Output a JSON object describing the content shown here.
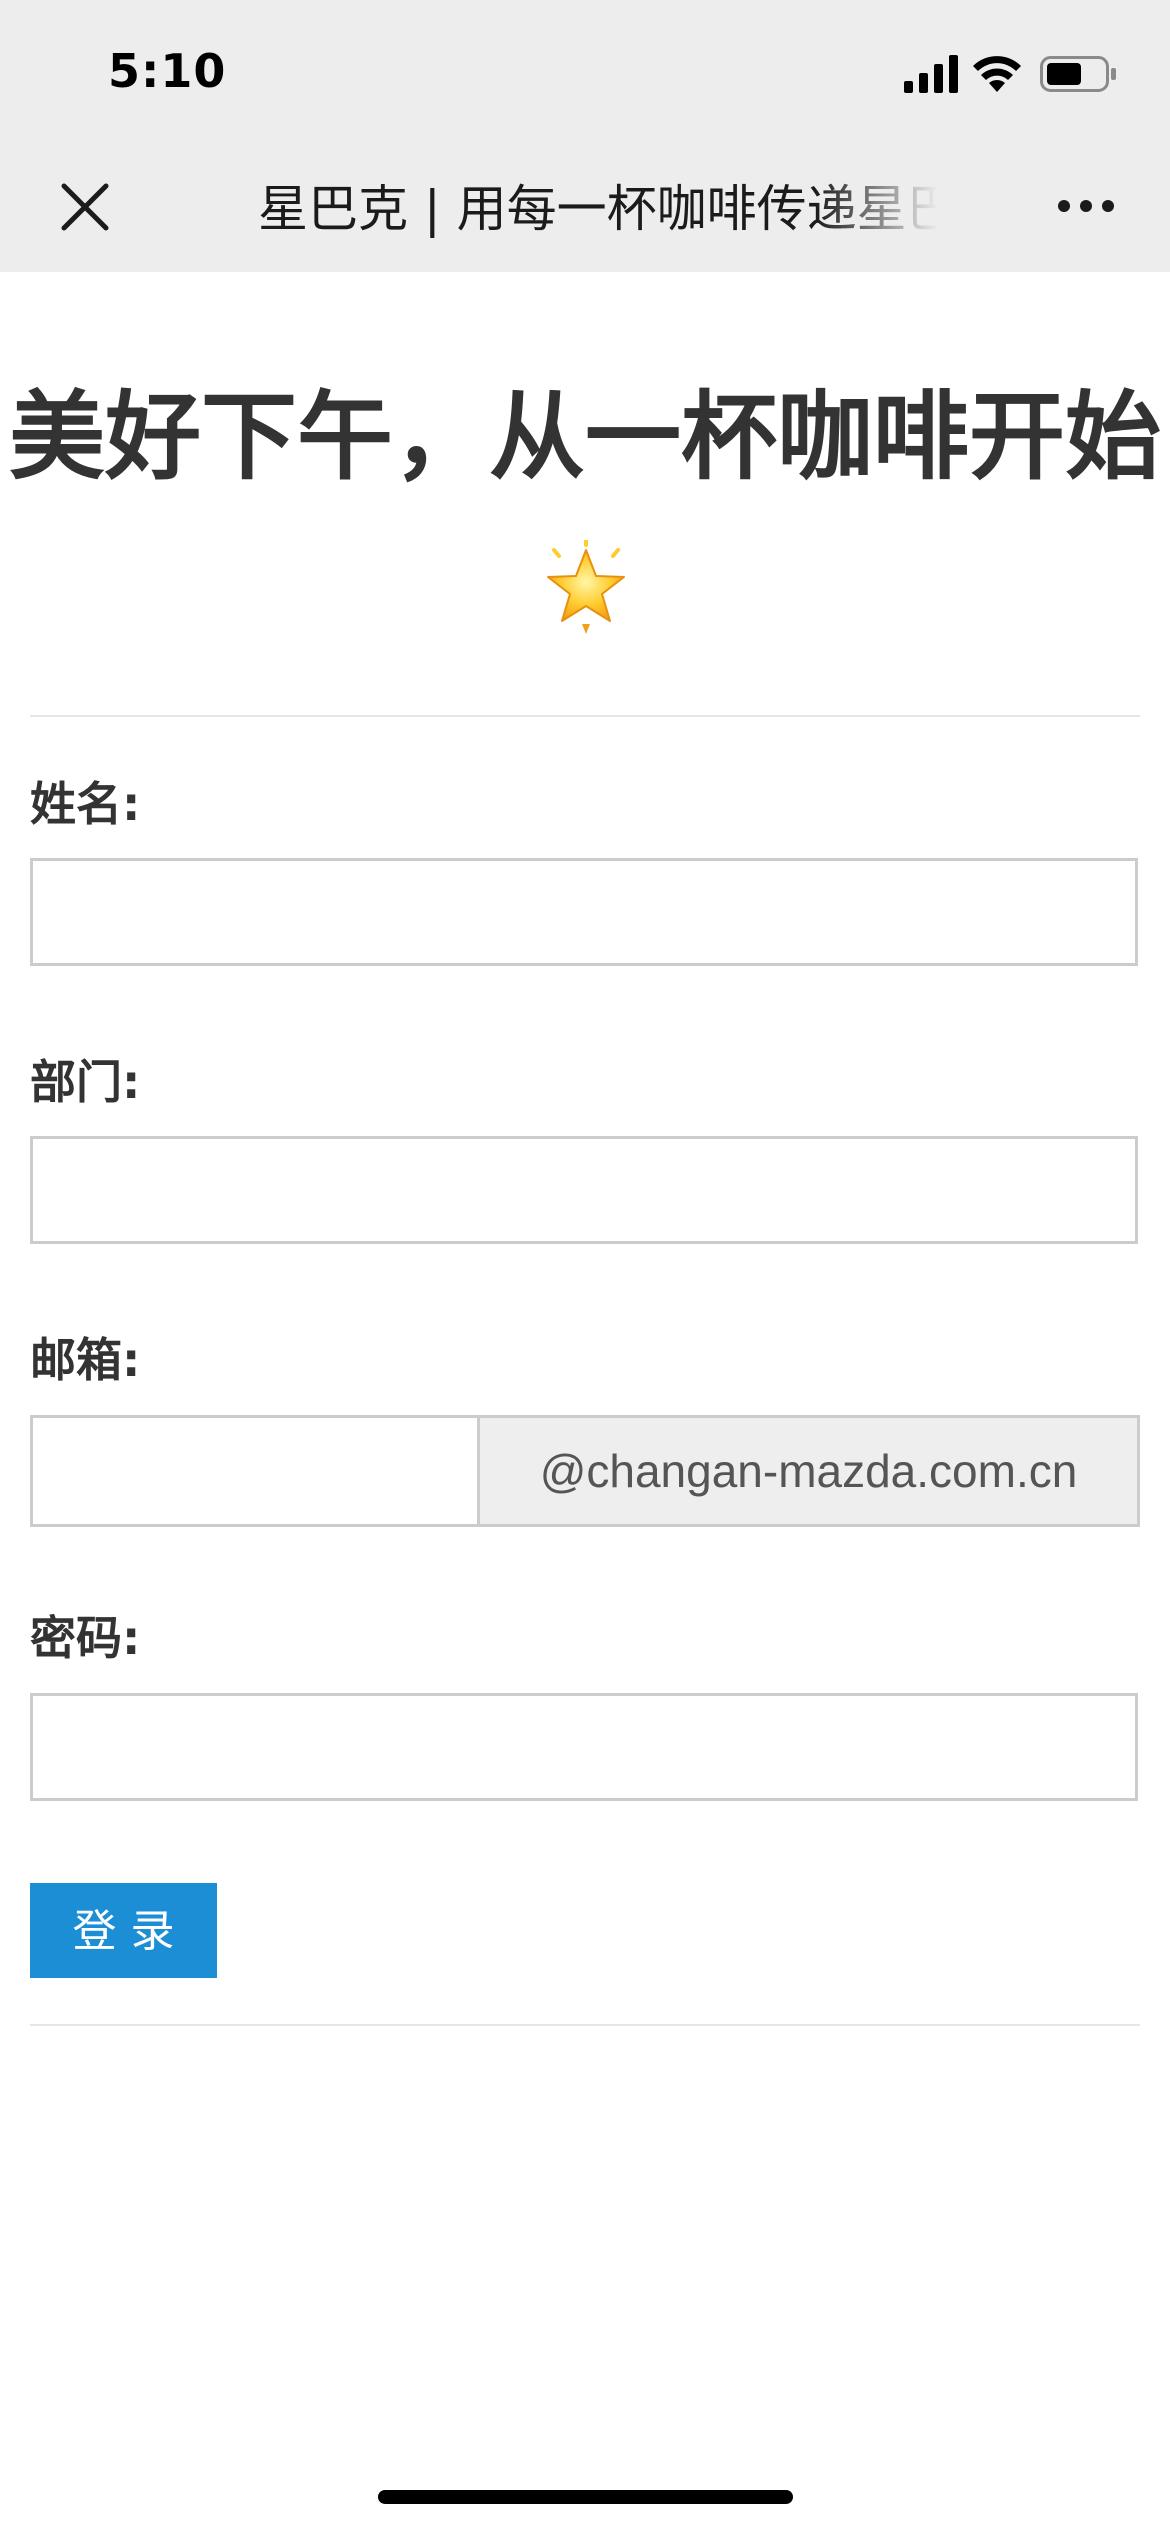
{
  "status_bar": {
    "time": "5:10"
  },
  "nav": {
    "title": "星巴克 | 用每一杯咖啡传递星巴克独特的咖啡体验",
    "close_icon": "close-icon",
    "more_icon": "more-icon"
  },
  "page": {
    "headline": "美好下午，从一杯咖啡开始",
    "star_icon": "glowing-star-icon"
  },
  "form": {
    "name_label": "姓名:",
    "name_value": "",
    "department_label": "部门:",
    "department_value": "",
    "email_label": "邮箱:",
    "email_value": "",
    "email_suffix": "@changan-mazda.com.cn",
    "password_label": "密码:",
    "password_value": "",
    "login_label": "登录"
  },
  "colors": {
    "topbar_bg": "#ededed",
    "button_bg": "#1b8ed6",
    "text": "#333333",
    "input_border": "#cccccc",
    "suffix_bg": "#eeeeee"
  }
}
